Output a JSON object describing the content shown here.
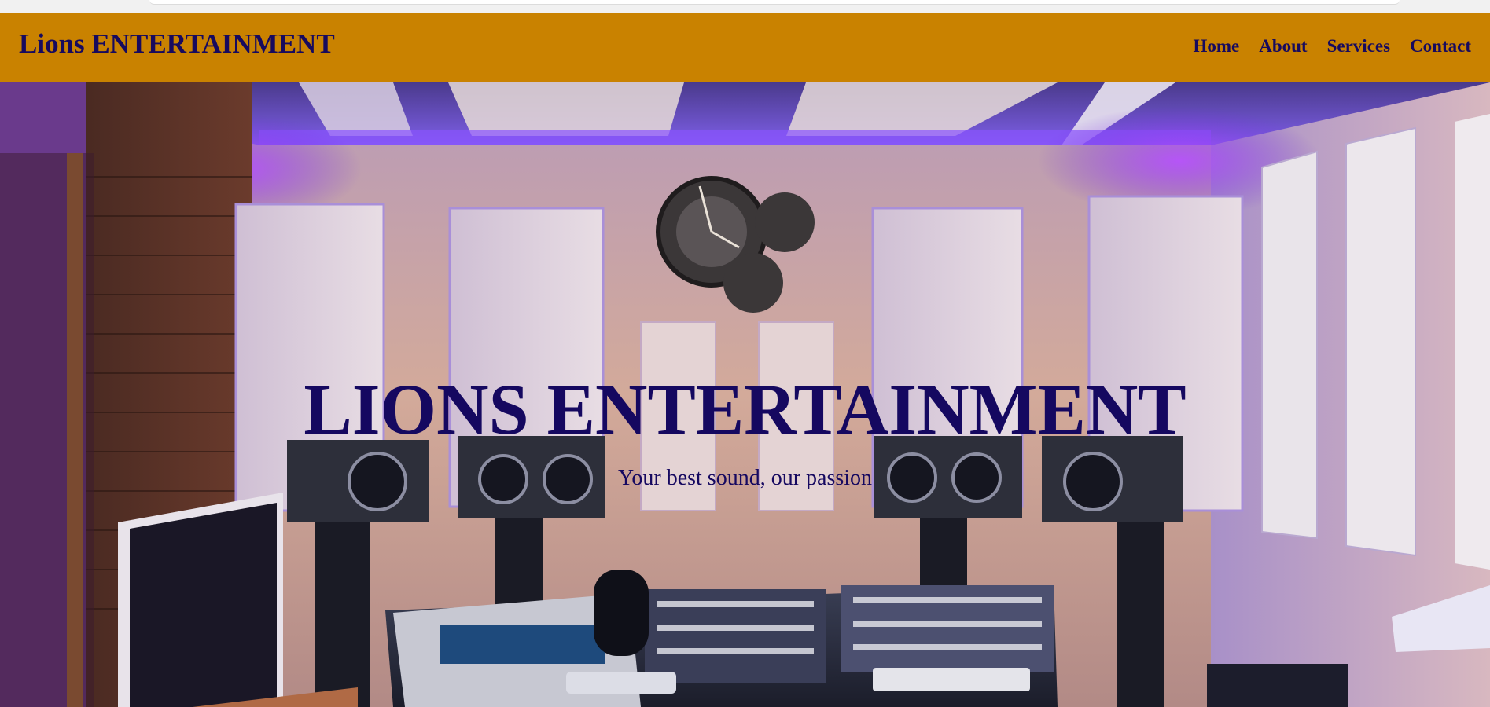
{
  "browser": {
    "top_strip": "browser-top-strip"
  },
  "navbar": {
    "brand": "Lions ENTERTAINMENT",
    "links": [
      "Home",
      "About",
      "Services",
      "Contact"
    ],
    "background_color": "#c98200",
    "text_color": "#170a5e"
  },
  "hero": {
    "title": "LIONS ENTERTAINMENT",
    "subtitle": "Your best sound, our passion",
    "background_description_icon": "recording-studio-photo",
    "title_color": "#150860"
  }
}
